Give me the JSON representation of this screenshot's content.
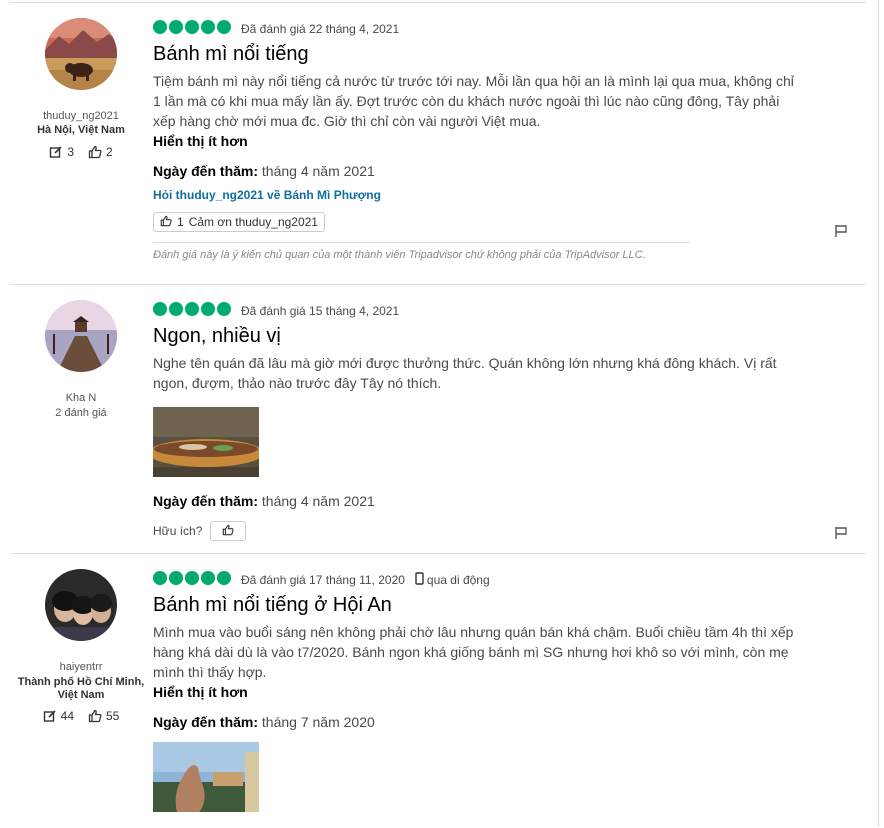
{
  "colors": {
    "bubble": "#00aa6c",
    "link": "#0e6ea0"
  },
  "reviews": [
    {
      "username": "thuduy_ng2021",
      "location": "Hà Nội, Việt Nam",
      "contributions": "3",
      "helpful_votes": "2",
      "rating": 5,
      "date": "Đã đánh giá 22 tháng 4, 2021",
      "title": "Bánh mì nổi tiếng",
      "text": "Tiệm bánh mì này nổi tiếng cả nước từ trước tới nay. Mỗi lần qua hội an là mình lại qua mua, không chỉ 1 lần mà có khi mua mấy lần ấy. Đợt trước còn du khách nước ngoài thì lúc nào cũng đông, Tây phải xếp hàng chờ mới mua đc. Giờ thì chỉ còn vài người Việt mua.",
      "toggle": "Hiển thị ít hơn",
      "visit_label": "Ngày đến thăm:",
      "visit_date": "tháng 4 năm 2021",
      "ask": "Hỏi thuduy_ng2021 về Bánh Mì Phượng",
      "thanks_count": "1",
      "thanks_label": "Cảm ơn thuduy_ng2021",
      "disclaimer": "Đánh giá này là ý kiến chủ quan của một thành viên Tripadvisor chứ không phải của TripAdvisor LLC."
    },
    {
      "username": "Kha N",
      "reviews_count": "2 đánh giá",
      "rating": 5,
      "date": "Đã đánh giá 15 tháng 4, 2021",
      "title": "Ngon, nhiều vị",
      "text": "Nghe tên quán đã lâu mà giờ mới được thưởng thức. Quán không lớn nhưng khá đông khách. Vị rất ngon, đượm, thảo nào trước đây Tây nó thích.",
      "photo": "sandwich-photo",
      "visit_label": "Ngày đến thăm:",
      "visit_date": "tháng 4 năm 2021",
      "helpful_label": "Hữu ích?"
    },
    {
      "username": "haiyentrr",
      "location": "Thành phố Hồ Chí Minh, Việt Nam",
      "contributions": "44",
      "helpful_votes": "55",
      "rating": 5,
      "date": "Đã đánh giá 17 tháng 11, 2020",
      "via": "qua di động",
      "title": "Bánh mì nổi tiếng ở Hội An",
      "text": "Mình mua vào buổi sáng nên không phải chờ lâu nhưng quán bán khá chậm. Buổi chiều tầm 4h thì xếp hàng khá dài dù là vào t7/2020. Bánh ngon khá giống bánh mì SG nhưng hơi khô so với mình, còn mẹ mình thì thấy hợp.",
      "toggle": "Hiển thị ít hơn",
      "visit_label": "Ngày đến thăm:",
      "visit_date": "tháng 7 năm 2020",
      "photo": "street-photo"
    }
  ]
}
